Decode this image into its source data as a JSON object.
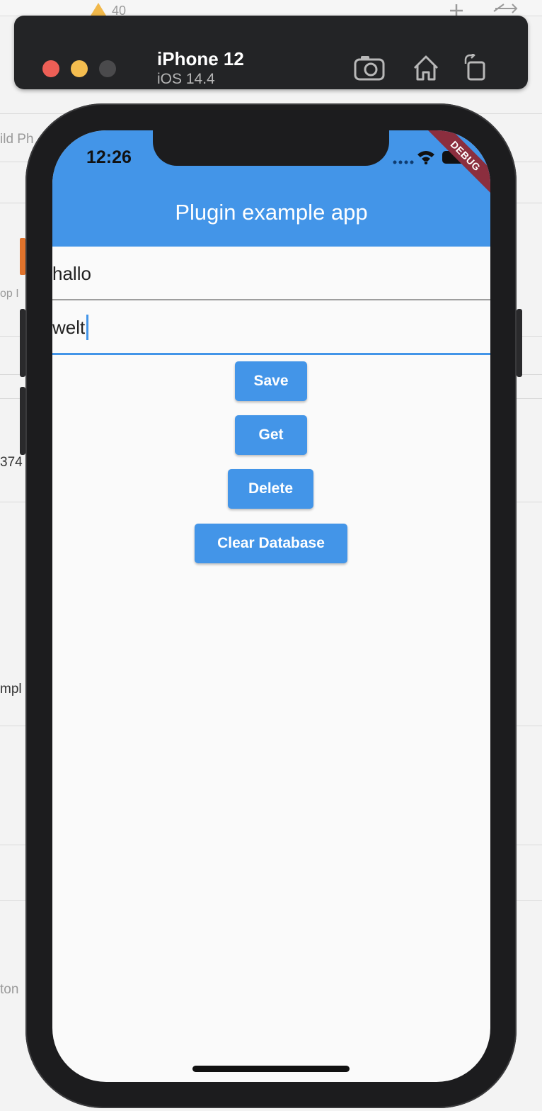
{
  "background": {
    "warning_count": "40",
    "fragments": [
      "ild Ph",
      "op I",
      "374",
      "mpl",
      "ton"
    ]
  },
  "simulator": {
    "device_name": "iPhone 12",
    "os_version": "iOS 14.4",
    "icons": [
      "camera-icon",
      "home-icon",
      "rotate-icon"
    ]
  },
  "status_bar": {
    "time": "12:26",
    "icons": [
      "wifi-icon",
      "battery-icon"
    ]
  },
  "debug_banner": "DEBUG",
  "app_bar": {
    "title": "Plugin example app"
  },
  "fields": {
    "key_value": "hallo",
    "value_value": "welt"
  },
  "buttons": {
    "save": "Save",
    "get": "Get",
    "delete": "Delete",
    "clear": "Clear Database"
  },
  "colors": {
    "primary": "#4395e8",
    "debug": "#8b2e3e"
  }
}
